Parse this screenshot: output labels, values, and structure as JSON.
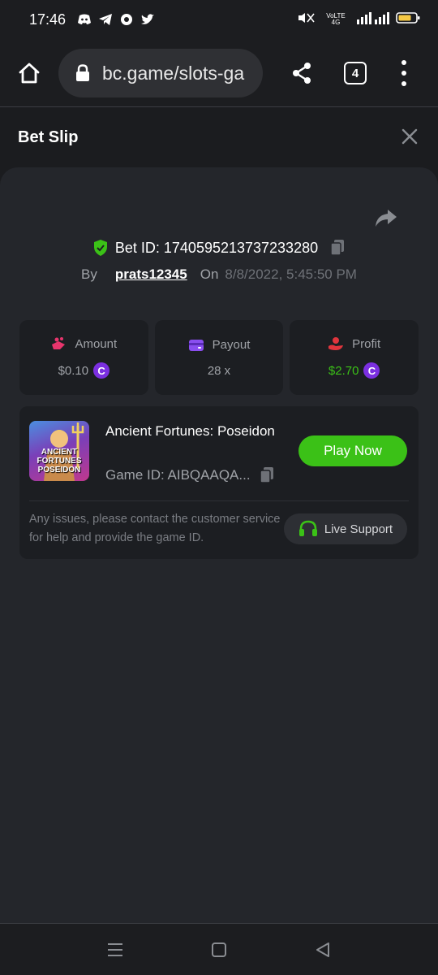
{
  "status": {
    "time": "17:46",
    "right_text": "VoLTE 4G"
  },
  "browser": {
    "url": "bc.game/slots-ga",
    "tab_count": "4"
  },
  "slip": {
    "title": "Bet Slip",
    "bet_id_label": "Bet ID: 1740595213737233280",
    "by_label": "By",
    "username": "prats12345",
    "on_label": "On",
    "date": "8/8/2022, 5:45:50 PM"
  },
  "stats": {
    "amount_label": "Amount",
    "amount_value": "$0.10",
    "payout_label": "Payout",
    "payout_value": "28 x",
    "profit_label": "Profit",
    "profit_value": "$2.70",
    "coin_symbol": "C"
  },
  "game": {
    "name": "Ancient Fortunes: Poseidon",
    "thumb_label": "ANCIENT FORTUNES POSEIDON",
    "game_id": "Game ID: AIBQAAQA...",
    "play_label": "Play Now",
    "help_text": "Any issues, please contact the customer service for help and provide the game ID.",
    "support_label": "Live Support"
  },
  "colors": {
    "accent_green": "#3bc117",
    "coin_purple": "#7b2fe0",
    "amount_pink": "#e8356d",
    "payout_purple": "#8a4ef0",
    "profit_red": "#e0353d"
  }
}
